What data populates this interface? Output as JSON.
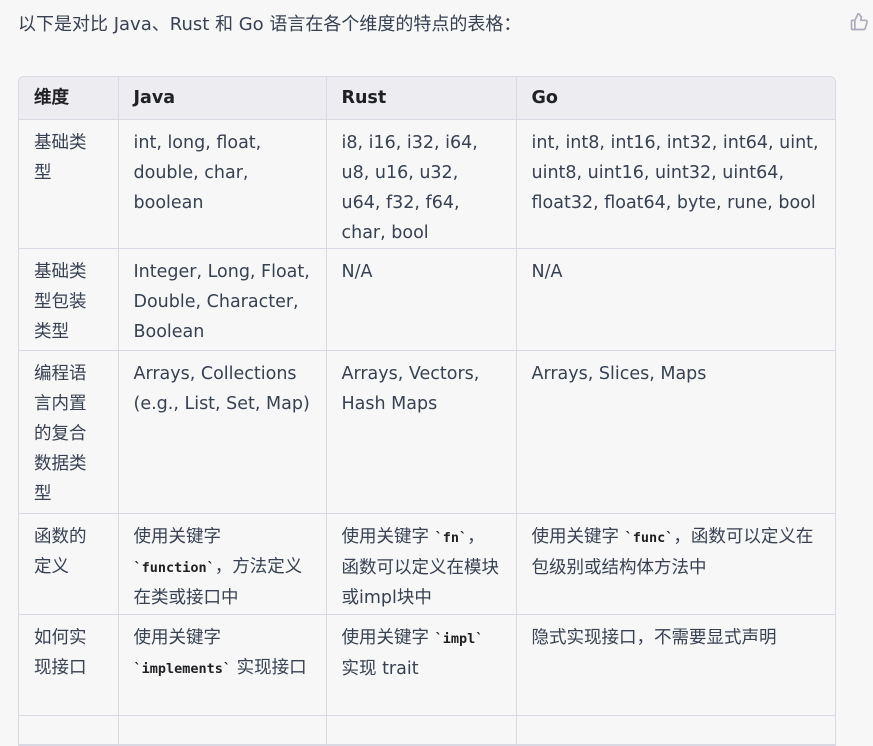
{
  "intro": "以下是对比 Java、Rust 和 Go 语言在各个维度的特点的表格：",
  "feedback_icon": "thumbs-up-icon",
  "table": {
    "headers": [
      "维度",
      "Java",
      "Rust",
      "Go"
    ],
    "rows": [
      {
        "dim": "基础类型",
        "java": "int, long, float, double, char, boolean",
        "rust": "i8, i16, i32, i64, u8, u16, u32, u64, f32, f64, char, bool",
        "go": "int, int8, int16, int32, int64, uint, uint8, uint16, uint32, uint64, float32, float64, byte, rune, bool"
      },
      {
        "dim": "基础类型包装类型",
        "java": "Integer, Long, Float, Double, Character, Boolean",
        "rust": "N/A",
        "go": "N/A"
      },
      {
        "dim": "编程语言内置的复合数据类型",
        "java": "Arrays, Collections (e.g., List, Set, Map)",
        "rust": "Arrays, Vectors, Hash Maps",
        "go": "Arrays, Slices, Maps"
      },
      {
        "dim": "函数的定义",
        "java_prefix": "使用关键字 ",
        "java_code": "`function`",
        "java_suffix": "，方法定义在类或接口中",
        "rust_prefix": "使用关键字 ",
        "rust_code": "`fn`",
        "rust_suffix": "，函数可以定义在模块或impl块中",
        "go_prefix": "使用关键字 ",
        "go_code": "`func`",
        "go_suffix": "，函数可以定义在包级别或结构体方法中"
      },
      {
        "dim": "如何实现接口",
        "java_prefix": "使用关键字 ",
        "java_code": "`implements`",
        "java_suffix": " 实现接口",
        "rust_prefix": "使用关键字 ",
        "rust_code": "`impl`",
        "rust_suffix": " 实现 trait",
        "go": "隐式实现接口，不需要显式声明"
      }
    ]
  }
}
